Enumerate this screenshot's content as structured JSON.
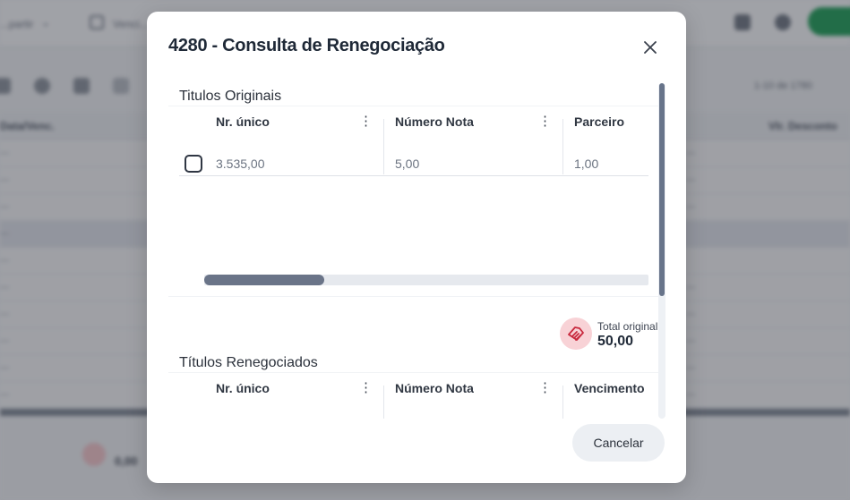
{
  "background": {
    "toolbar_left_text": "...partir",
    "date_label": "Venci...",
    "page_info": "1-10 de 1780",
    "col_left": "Data/Venc.",
    "col_right": "Vlr. Desconto",
    "footer_value": "0,00"
  },
  "modal": {
    "title": "4280 - Consulta de Renegociação",
    "close_icon": "close-icon",
    "originals": {
      "title": "Titulos Originais",
      "columns": [
        "Nr. único",
        "Número Nota",
        "Parceiro"
      ],
      "rows": [
        {
          "nr_unico": "3.535,00",
          "numero_nota": "5,00",
          "parceiro": "1,00"
        }
      ],
      "hscroll_fraction": 0.27
    },
    "total": {
      "icon": "handshake-icon",
      "label": "Total original",
      "value": "50,00"
    },
    "renegotiated": {
      "title": "Títulos Renegociados",
      "columns": [
        "Nr. único",
        "Número Nota",
        "Vencimento"
      ]
    },
    "cancel_label": "Cancelar"
  },
  "colors": {
    "accent_red": "#c8283d",
    "scroll_thumb": "#68748a",
    "overlay": "rgba(40,44,52,0.42)"
  }
}
